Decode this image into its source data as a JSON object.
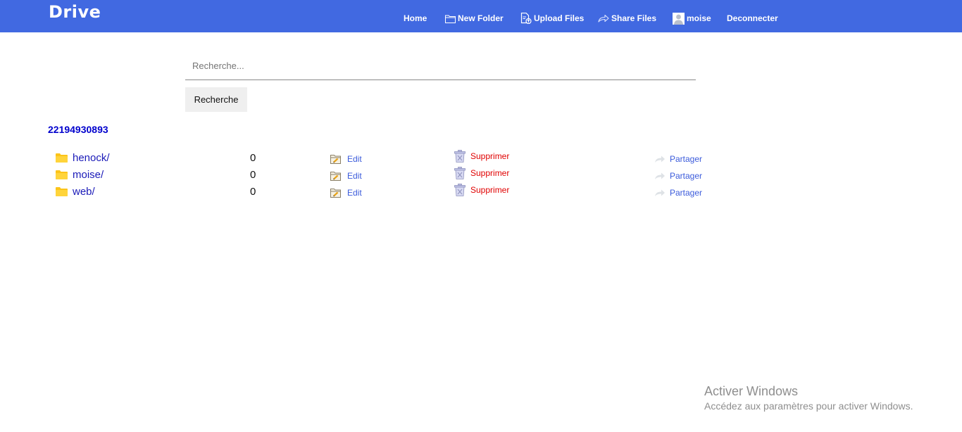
{
  "header": {
    "logo": "Drive",
    "nav": {
      "home": "Home",
      "new_folder": "New Folder",
      "upload_files": "Upload Files",
      "share_files": "Share Files",
      "user": "moise",
      "logout": "Deconnecter"
    },
    "colors": {
      "bar": "#4169e1"
    }
  },
  "search": {
    "placeholder": "Recherche...",
    "value": "",
    "button_label": "Recherche"
  },
  "account_id": "22194930893",
  "files": [
    {
      "name": "henock/",
      "count": "0",
      "edit_label": "Edit",
      "delete_label": "Supprimer",
      "share_label": "Partager"
    },
    {
      "name": "moise/",
      "count": "0",
      "edit_label": "Edit",
      "delete_label": "Supprimer",
      "share_label": "Partager"
    },
    {
      "name": "web/",
      "count": "0",
      "edit_label": "Edit",
      "delete_label": "Supprimer",
      "share_label": "Partager"
    }
  ],
  "icons": {
    "folder": "folder-icon",
    "edit": "edit-icon",
    "delete": "trash-icon",
    "share": "share-arrow-icon"
  },
  "watermark": {
    "title": "Activer Windows",
    "subtitle": "Accédez aux paramètres pour activer Windows."
  }
}
